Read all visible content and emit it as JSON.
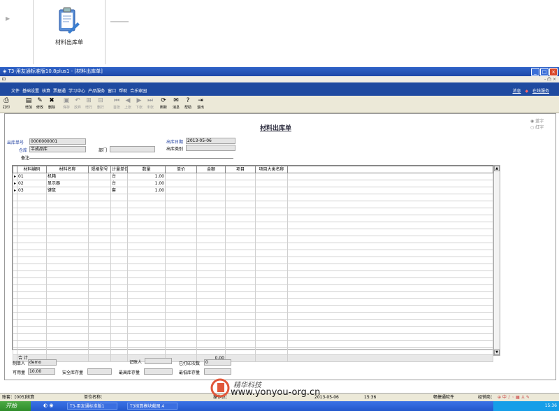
{
  "shortcut": {
    "label": "材料出库单"
  },
  "window": {
    "title": "T3-用友通标准版10.8plus1 - [材料出库单]",
    "sub": "- 凸 ×"
  },
  "menu": {
    "items": [
      "文件",
      "基础设置",
      "核算",
      "票据通",
      "学习中心",
      "产品服务",
      "窗口",
      "帮助",
      "合乐家园"
    ],
    "right": [
      "消息",
      "在线服务"
    ]
  },
  "toolbar": {
    "buttons": [
      {
        "label": "打印",
        "icon": "print-icon",
        "enabled": true
      },
      {
        "label": "增加",
        "icon": "add-icon",
        "enabled": true
      },
      {
        "label": "修改",
        "icon": "edit-icon",
        "enabled": true
      },
      {
        "label": "删除",
        "icon": "delete-icon",
        "enabled": true
      },
      {
        "label": "保存",
        "icon": "save-icon",
        "enabled": false
      },
      {
        "label": "放弃",
        "icon": "cancel-icon",
        "enabled": false
      },
      {
        "label": "增行",
        "icon": "add-row-icon",
        "enabled": false
      },
      {
        "label": "删行",
        "icon": "delete-row-icon",
        "enabled": false
      },
      {
        "label": "首张",
        "icon": "first-icon",
        "enabled": false
      },
      {
        "label": "上张",
        "icon": "prev-icon",
        "enabled": false
      },
      {
        "label": "下张",
        "icon": "next-icon",
        "enabled": false
      },
      {
        "label": "末张",
        "icon": "last-icon",
        "enabled": false
      },
      {
        "label": "刷新",
        "icon": "refresh-icon",
        "enabled": true
      },
      {
        "label": "消息",
        "icon": "message-icon",
        "enabled": true
      },
      {
        "label": "帮助",
        "icon": "help-icon",
        "enabled": true
      },
      {
        "label": "退出",
        "icon": "exit-icon",
        "enabled": true
      }
    ]
  },
  "form": {
    "title": "材料出库单",
    "radio_blue": "蓝字",
    "radio_red": "红字",
    "doc_no_label": "出库单号",
    "doc_no": "0000000001",
    "date_label": "出库日期",
    "date": "2013-05-06",
    "warehouse_label": "仓库",
    "warehouse": "半成品库",
    "dept_label": "部门",
    "dept": "",
    "category_label": "出库类别",
    "category": "",
    "remark_label": "备注",
    "remark": ""
  },
  "grid": {
    "headers": [
      "材料编码",
      "材料名称",
      "规格型号",
      "计量单位",
      "数量",
      "单价",
      "金额",
      "项目",
      "项目大类名称"
    ],
    "rows": [
      {
        "code": "01",
        "name": "机箱",
        "spec": "",
        "unit": "台",
        "qty": "1.00",
        "price": "",
        "amount": "",
        "project": "",
        "pclass": ""
      },
      {
        "code": "02",
        "name": "显示器",
        "spec": "",
        "unit": "台",
        "qty": "1.00",
        "price": "",
        "amount": "",
        "project": "",
        "pclass": ""
      },
      {
        "code": "03",
        "name": "键鼠",
        "spec": "",
        "unit": "套",
        "qty": "1.00",
        "price": "",
        "amount": "",
        "project": "",
        "pclass": ""
      }
    ],
    "empty_rows": 23,
    "total_label": "合  计",
    "total_amount": "0.00"
  },
  "footer": {
    "maker_label": "制单人",
    "maker": "demo",
    "bookkeeper_label": "记账人",
    "bookkeeper": "",
    "print_count_label": "已打印次数",
    "print_count": "0",
    "available_label": "可用量",
    "available": "10.00",
    "safety_label": "安全库存量",
    "safety": "",
    "max_label": "最高库存量",
    "max": "",
    "min_label": "最低库存量",
    "min": ""
  },
  "status": {
    "account": "账套：[005]核算",
    "unit": "单位名称：",
    "operator": "操作员：",
    "business_date": "2013-05-06",
    "time": "15:36",
    "product": "畅捷通软件",
    "dealer": "经销商："
  },
  "taskbar": {
    "start": "开始",
    "tasks": [
      "T3-用友通标准版1",
      "T3核算模块截图.4"
    ],
    "clock": "15:36"
  },
  "watermark": {
    "text": "精华科技",
    "url": "www.yonyou-org.cn"
  }
}
